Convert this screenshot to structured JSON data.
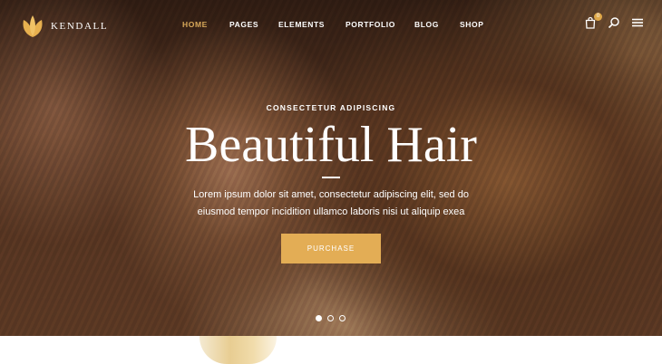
{
  "brand": {
    "name": "KENDALL"
  },
  "nav": {
    "items": [
      {
        "label": "HOME",
        "active": true
      },
      {
        "label": "PAGES",
        "active": false
      },
      {
        "label": "ELEMENTS",
        "active": false
      },
      {
        "label": "PORTFOLIO",
        "active": false
      },
      {
        "label": "BLOG",
        "active": false
      },
      {
        "label": "SHOP",
        "active": false
      }
    ]
  },
  "header_tools": {
    "cart_icon": "shopping-bag-icon",
    "cart_count": "0",
    "search_icon": "search-icon",
    "menu_icon": "hamburger-menu-icon"
  },
  "hero": {
    "subtitle": "CONSECTETUR ADIPISCING",
    "title": "Beautiful Hair",
    "description_line1": "Lorem ipsum dolor sit amet, consectetur adipiscing elit, sed do",
    "description_line2": "eiusmod tempor incidition ullamco laboris nisi ut aliquip exea",
    "button_label": "PURCHASE"
  },
  "slider": {
    "slide_count": 3,
    "active_index": 0
  },
  "colors": {
    "accent": "#d9a95a",
    "button": "#e3ad55",
    "text": "#ffffff"
  }
}
